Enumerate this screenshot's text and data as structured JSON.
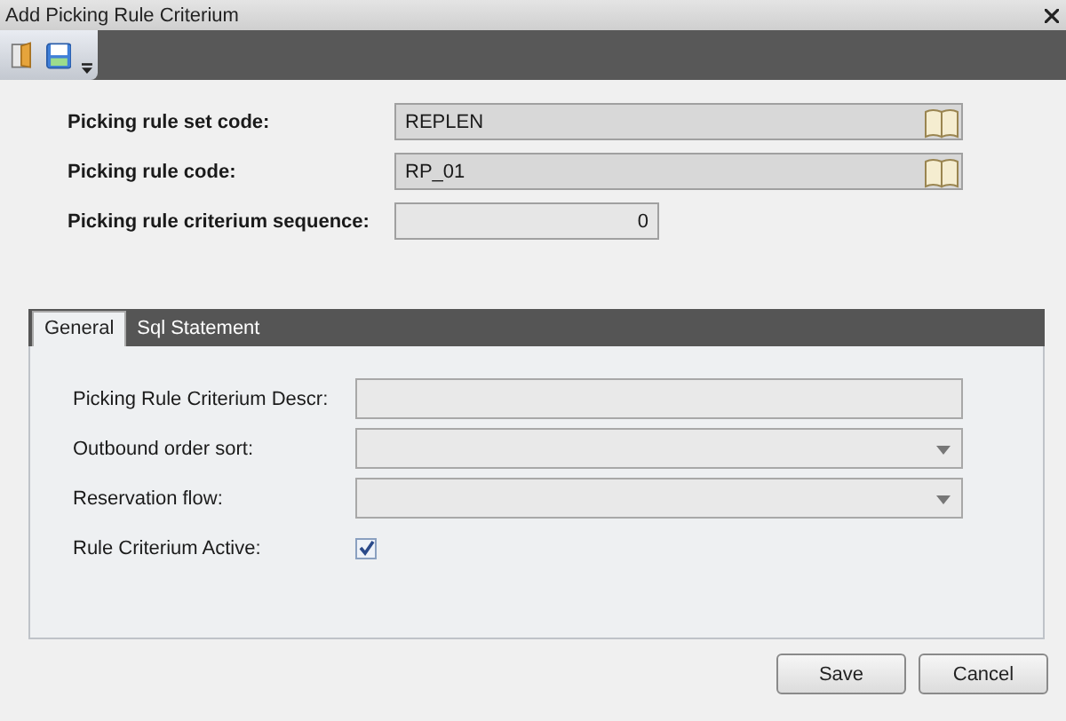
{
  "window": {
    "title": "Add Picking Rule Criterium"
  },
  "header_fields": [
    {
      "label": "Picking rule set code:",
      "value": "REPLEN",
      "kind": "lookup"
    },
    {
      "label": "Picking rule code:",
      "value": "RP_01",
      "kind": "lookup"
    },
    {
      "label": "Picking rule criterium sequence:",
      "value": "0",
      "kind": "number"
    }
  ],
  "tabs": [
    {
      "label": "General",
      "selected": true
    },
    {
      "label": "Sql Statement",
      "selected": false
    }
  ],
  "general_fields": [
    {
      "label": "Picking Rule Criterium Descr:",
      "kind": "text"
    },
    {
      "label": "Outbound order sort:",
      "kind": "dropdown"
    },
    {
      "label": "Reservation flow:",
      "kind": "dropdown"
    },
    {
      "label": "Rule Criterium Active:",
      "kind": "checkbox",
      "checked": true
    }
  ],
  "buttons": [
    "Save",
    "Cancel"
  ]
}
